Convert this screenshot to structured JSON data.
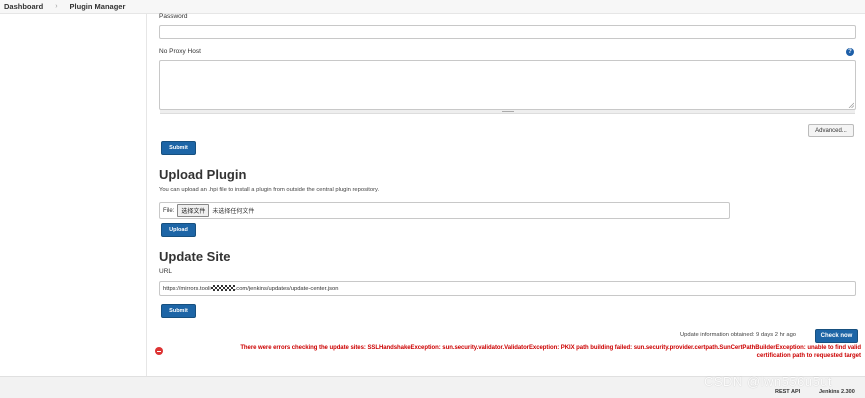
{
  "breadcrumb": {
    "items": [
      "Dashboard",
      "Plugin Manager"
    ],
    "separator": "›"
  },
  "proxy": {
    "password_label": "Password",
    "no_proxy_label": "No Proxy Host",
    "help_glyph": "?",
    "advanced_label": "Advanced...",
    "submit_label": "Submit"
  },
  "upload": {
    "title": "Upload Plugin",
    "description": "You can upload an .hpi file to install a plugin from outside the central plugin repository.",
    "file_label": "File:",
    "choose_button": "选择文件",
    "no_file": "未选择任何文件",
    "upload_label": "Upload"
  },
  "update_site": {
    "title": "Update Site",
    "url_label": "URL",
    "url_prefix": "https://mirrors.tooli",
    "url_suffix": ".com/jenkins/updates/update-center.json",
    "submit_label": "Submit"
  },
  "status": {
    "update_info": "Update information obtained: 9 days 2 hr ago",
    "check_now": "Check now",
    "error_line1": "There were errors checking the update sites: SSLHandshakeException: sun.security.validator.ValidatorException: PKIX path building failed: sun.security.provider.certpath.SunCertPathBuilderException: unable to find valid",
    "error_line2": "certification path to requested target"
  },
  "footer": {
    "rest_api": "REST API",
    "version": "Jenkins 2.300"
  },
  "watermark": "CSDN @lwn556u5ut",
  "colors": {
    "primary": "#1d65a6",
    "error": "#cc0000",
    "help": "#1e5fa8"
  },
  "icons": {
    "help": "help-icon",
    "error": "error-icon",
    "breadcrumb_separator": "chevron-right-icon"
  }
}
